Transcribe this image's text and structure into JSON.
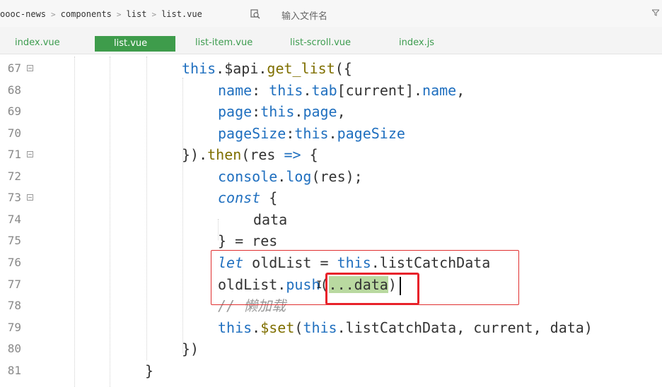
{
  "breadcrumb": [
    "oooc-news",
    "components",
    "list",
    "list.vue"
  ],
  "search": {
    "placeholder": "输入文件名"
  },
  "tabs": [
    {
      "label": "index.vue",
      "active": false
    },
    {
      "label": "list.vue",
      "active": true
    },
    {
      "label": "list-item.vue",
      "active": false
    },
    {
      "label": "list-scroll.vue",
      "active": false
    },
    {
      "label": "index.js",
      "active": false
    }
  ],
  "lines": [
    {
      "n": "67",
      "fold": true
    },
    {
      "n": "68",
      "fold": false
    },
    {
      "n": "69",
      "fold": false
    },
    {
      "n": "70",
      "fold": false
    },
    {
      "n": "71",
      "fold": true
    },
    {
      "n": "72",
      "fold": false
    },
    {
      "n": "73",
      "fold": true
    },
    {
      "n": "74",
      "fold": false
    },
    {
      "n": "75",
      "fold": false
    },
    {
      "n": "76",
      "fold": false
    },
    {
      "n": "77",
      "fold": false
    },
    {
      "n": "78",
      "fold": false
    },
    {
      "n": "79",
      "fold": false
    },
    {
      "n": "80",
      "fold": false
    },
    {
      "n": "81",
      "fold": false
    }
  ],
  "code": {
    "l67": [
      "this",
      ".$api.",
      "get_list",
      "({"
    ],
    "l68": [
      "name",
      ": ",
      "this",
      ".",
      "tab",
      "[current].",
      "name",
      ","
    ],
    "l69": [
      "page",
      ":",
      "this",
      ".",
      "page",
      ","
    ],
    "l70": [
      "pageSize",
      ":",
      "this",
      ".",
      "pageSize"
    ],
    "l71": [
      "}).",
      "then",
      "(res ",
      "=>",
      " {"
    ],
    "l72": [
      "console",
      ".",
      "log",
      "(res);"
    ],
    "l73": [
      "const",
      " {"
    ],
    "l74": [
      "data"
    ],
    "l75": [
      "} = res"
    ],
    "l76": [
      "let",
      " oldList = ",
      "this",
      ".",
      "listCatchData"
    ],
    "l77": [
      "oldList.",
      "push",
      "(",
      "...data",
      ")"
    ],
    "l78": [
      "// 懒加载"
    ],
    "l79": [
      "this",
      ".",
      "$set",
      "(",
      "this",
      ".",
      "listCatchData",
      ", current, data)"
    ],
    "l80": [
      "})"
    ],
    "l81": [
      "}"
    ]
  },
  "colors": {
    "accent": "#3e9c4b",
    "highlight_box": "#e8222a"
  }
}
